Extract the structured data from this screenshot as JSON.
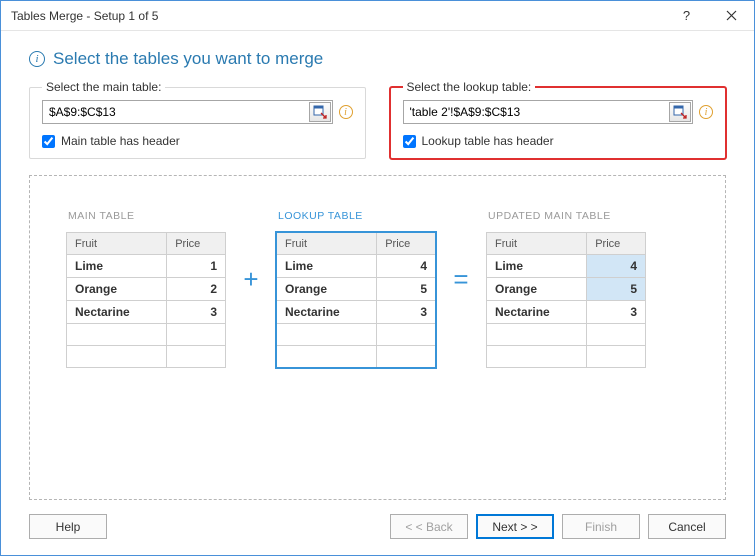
{
  "window": {
    "title": "Tables Merge - Setup 1 of 5"
  },
  "heading": "Select the tables you want to merge",
  "main": {
    "legend": "Select the main table:",
    "value": "$A$9:$C$13",
    "header_check": "Main table has header"
  },
  "lookup": {
    "legend": "Select the lookup table:",
    "value": "'table 2'!$A$9:$C$13",
    "header_check": "Lookup table has header"
  },
  "preview": {
    "labels": {
      "main": "MAIN TABLE",
      "lookup": "LOOKUP TABLE",
      "updated": "UPDATED MAIN TABLE"
    },
    "headers": {
      "fruit": "Fruit",
      "price": "Price"
    },
    "main_rows": [
      {
        "fruit": "Lime",
        "price": "1"
      },
      {
        "fruit": "Orange",
        "price": "2"
      },
      {
        "fruit": "Nectarine",
        "price": "3"
      }
    ],
    "lookup_rows": [
      {
        "fruit": "Lime",
        "price": "4"
      },
      {
        "fruit": "Orange",
        "price": "5"
      },
      {
        "fruit": "Nectarine",
        "price": "3"
      }
    ],
    "updated_rows": [
      {
        "fruit": "Lime",
        "price": "4",
        "hl": true
      },
      {
        "fruit": "Orange",
        "price": "5",
        "hl": true
      },
      {
        "fruit": "Nectarine",
        "price": "3",
        "hl": false
      }
    ]
  },
  "buttons": {
    "help": "Help",
    "back": "< < Back",
    "next": "Next > >",
    "finish": "Finish",
    "cancel": "Cancel"
  }
}
